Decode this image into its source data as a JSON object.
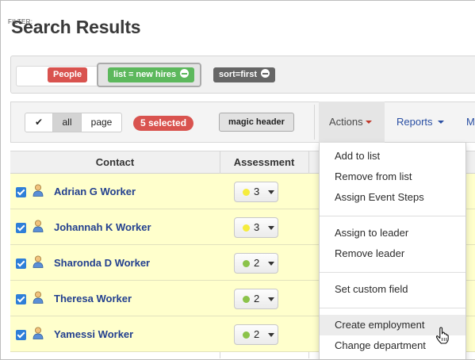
{
  "page": {
    "title": "Search Results"
  },
  "filter": {
    "label": "FILTER:",
    "chips": [
      {
        "label": "People",
        "color": "#d9534f"
      },
      {
        "label": "list = new hires",
        "color": "#5cb85c"
      },
      {
        "label": "sort=first",
        "color": "#666666"
      }
    ]
  },
  "toolbar": {
    "select_check": "✔",
    "select_all": "all",
    "select_page": "page",
    "selected_badge": "5 selected",
    "magic_header": "magic header",
    "actions": "Actions",
    "reports": "Reports",
    "more": "M"
  },
  "table": {
    "columns": [
      "Contact",
      "Assessment"
    ],
    "rows": [
      {
        "name": "Adrian G Worker",
        "score": "3",
        "score_color": "#f5ec3d"
      },
      {
        "name": "Johannah K Worker",
        "score": "3",
        "score_color": "#f5ec3d"
      },
      {
        "name": "Sharonda D Worker",
        "score": "2",
        "score_color": "#8bc34a"
      },
      {
        "name": "Theresa Worker",
        "score": "2",
        "score_color": "#8bc34a"
      },
      {
        "name": "Yamessi Worker",
        "score": "2",
        "score_color": "#8bc34a"
      }
    ]
  },
  "actions_menu": {
    "items": [
      "Add to list",
      "Remove from list",
      "Assign Event Steps",
      "Assign to leader",
      "Remove leader",
      "Set custom field",
      "Create employment",
      "Change department"
    ],
    "hovered": "Create employment"
  }
}
